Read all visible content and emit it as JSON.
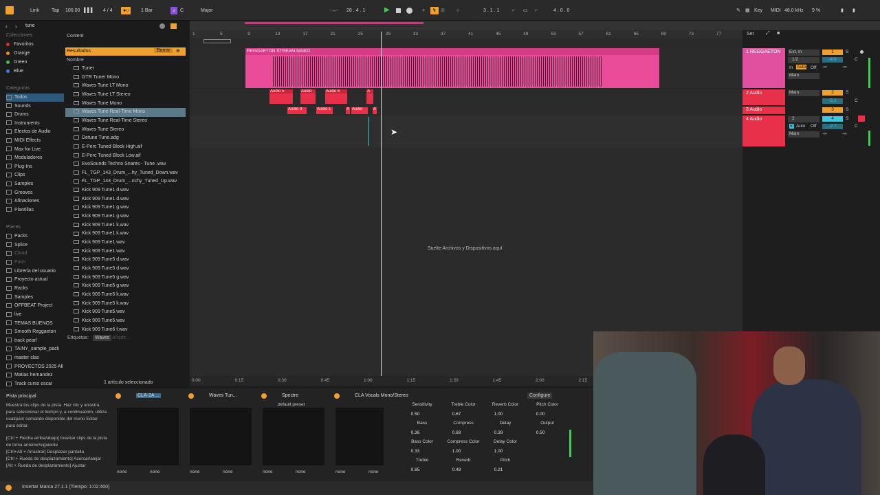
{
  "transport": {
    "link": "Link",
    "tap": "Tap",
    "tempo": "100.00",
    "signature": "4 / 4",
    "quantize": "1 Bar",
    "key_root": "C",
    "scale": "Major",
    "position": "28 .  4 .  1",
    "loop_start": "3 .  1 .  1",
    "loop_length": "4 .  0 .  0",
    "key": "Key",
    "midi": "MIDI",
    "sample_rate": "48.0 kHz",
    "cpu": "9 %"
  },
  "browser": {
    "search": "tune",
    "content_label": "Content",
    "results_label": "Resultados",
    "clear_label": "Borrar",
    "name_header": "Nombre",
    "tags_label": "Etiquetas:",
    "tag": "Waves",
    "tag_add": "Añadir...",
    "status": "1 artículo seleccionado",
    "sidebar": {
      "collections_title": "Colecciones",
      "collections": [
        {
          "label": "Favoritos",
          "color": "#e03030"
        },
        {
          "label": "Orange",
          "color": "#f08a20"
        },
        {
          "label": "Green",
          "color": "#3cc050"
        },
        {
          "label": "Blue",
          "color": "#3a80e0"
        }
      ],
      "categories_title": "Categorías",
      "categories": [
        "Todos",
        "Sounds",
        "Drums",
        "Instruments",
        "Efectos de Audio",
        "MIDI Effects",
        "Max for Live",
        "Moduladores",
        "Plug-Ins",
        "Clips",
        "Samples",
        "Grooves",
        "Afinaciones",
        "Plantillas"
      ],
      "places_title": "Places",
      "places": [
        "Packs",
        "Splice",
        "Cloud",
        "Push",
        "Librería del usuario",
        "Proyecto actual",
        "Racks",
        "Samples",
        "OFFBEAT Project",
        "live",
        "TEMAS BUENOS",
        "Smooth Reggaeton",
        "track pearl",
        "TAINY_sample_pack",
        "master clas",
        "PROYECTOS 2025 All",
        "Matias hernandez",
        "Track curso oscar"
      ]
    },
    "items": [
      "Tuner",
      "GTR Tuner Mono",
      "Waves Tune LT Mono",
      "Waves Tune LT Stereo",
      "Waves Tune Mono",
      "Waves Tune Real-Time Mono",
      "Waves Tune Real-Time Stereo",
      "Waves Tune Stereo",
      "Detune Tune.adg",
      "E-Perc Tuned Block High.aif",
      "E-Perc Tuned Block Low.aif",
      "EvoSounds Techno Snares - Tune .wav",
      "FL_TGP_143_Drum_...hy_Tuned_Down.wav",
      "FL_TGP_143_Drum_...nchy_Tuned_Up.wav",
      "Kick 909 Tune1 d.wav",
      "Kick 909 Tune1 d.wav",
      "Kick 909 Tune1 g.wav",
      "Kick 909 Tune1 g.wav",
      "Kick 909 Tune1 k.wav",
      "Kick 909 Tune1 k.wav",
      "Kick 909 Tune1.wav",
      "Kick 909 Tune1.wav",
      "Kick 909 Tune5 d.wav",
      "Kick 909 Tune5 d.wav",
      "Kick 909 Tune5 g.wav",
      "Kick 909 Tune5 g.wav",
      "Kick 909 Tune5 k.wav",
      "Kick 909 Tune5 k.wav",
      "Kick 909 Tune5.wav",
      "Kick 909 Tune5.wav",
      "Kick 909 Tune6 f.wav"
    ]
  },
  "arrangement": {
    "bars": [
      "1",
      "5",
      "9",
      "13",
      "17",
      "21",
      "25",
      "29",
      "33",
      "37",
      "41",
      "45",
      "49",
      "53",
      "57",
      "61",
      "65",
      "69",
      "73",
      "77"
    ],
    "set": "Set",
    "main_clip": "REGGAETON STREAM NAIKO",
    "audio_clips_a": [
      "Audio 5",
      "Audio",
      "Audio 6",
      "A"
    ],
    "audio_clips_b": [
      "Audio 8",
      "Audio 1",
      "A",
      "Audio",
      "A"
    ],
    "drop_text": "Suelte Archivos y Dispositivos aquí",
    "times": [
      "0:00",
      "0:15",
      "0:30",
      "0:45",
      "1:00",
      "1:15",
      "1:30",
      "1:45",
      "2:00",
      "2:15"
    ]
  },
  "tracks": [
    {
      "name": "1 REGGAETON",
      "input": "Ext. In",
      "ch": "1/2",
      "out": "Main",
      "num": "1",
      "vol": "-4.0",
      "pan": "C",
      "in": "In",
      "auto": "Auto",
      "off": "Off",
      "inf": "-∞"
    },
    {
      "name": "2 Audio",
      "out": "Main",
      "num": "2",
      "vol": "-5.1",
      "pan": "C"
    },
    {
      "name": "3 Audio",
      "num": "3"
    },
    {
      "name": "4 Audio",
      "ch": "2",
      "out": "Main",
      "num": "4",
      "vol": "-2.7",
      "pan": "C",
      "in": "In",
      "auto": "Auto",
      "off": "Off",
      "inf": "-∞"
    }
  ],
  "info": {
    "title": "Pista principal",
    "body": "Muestra los clips de la pista. Haz clic y arrastra para seleccionar el tiempo y, a continuación, utiliza cualquier comando disponible del menú Editar para editar.",
    "shortcuts": "[Ctrl + Flecha arriba/abajo] Insertar clips de la pista de toma anterior/siguiente\n[Ctrl+Alt + Arrastrar] Desplazar pantalla\n[Ctrl + Rueda de desplazamiento] Acercar/alejar\n[Alt + Rueda de desplazamiento] Ajustar"
  },
  "devices": [
    {
      "name": "CLA-2A ...",
      "none": "none"
    },
    {
      "name": "Waves Tun...",
      "none": "none"
    },
    {
      "name": "Spectre",
      "preset": "default preset",
      "none": "none"
    },
    {
      "name": "CLA Vocals Mono/Stereo",
      "configure": "Configure",
      "none": "none"
    }
  ],
  "cla_params": [
    {
      "label": "Sensitivity",
      "value": "0.50"
    },
    {
      "label": "Treble Color",
      "value": "0.67"
    },
    {
      "label": "Reverb Color",
      "value": "1.00"
    },
    {
      "label": "Pitch Color",
      "value": "0.00"
    },
    {
      "label": "Bass",
      "value": "0.36"
    },
    {
      "label": "Compress",
      "value": "0.69"
    },
    {
      "label": "Delay",
      "value": "0.39"
    },
    {
      "label": "Output",
      "value": "0.50"
    },
    {
      "label": "Bass Color",
      "value": "0.33"
    },
    {
      "label": "Compress Color",
      "value": "1.00"
    },
    {
      "label": "Delay Color",
      "value": "1.00"
    },
    {
      "label": "",
      "value": ""
    },
    {
      "label": "Treble",
      "value": "0.65"
    },
    {
      "label": "Reverb",
      "value": "0.48"
    },
    {
      "label": "Pitch",
      "value": "0.21"
    }
  ],
  "status": {
    "text": "Insertar Marca 27.1.1 (Tiempo: 1:02:400)"
  },
  "colors": {
    "accent": "#f0a030",
    "clip": "#ea4c9a",
    "red": "#e8304a",
    "cyan": "#3ec9e0"
  }
}
